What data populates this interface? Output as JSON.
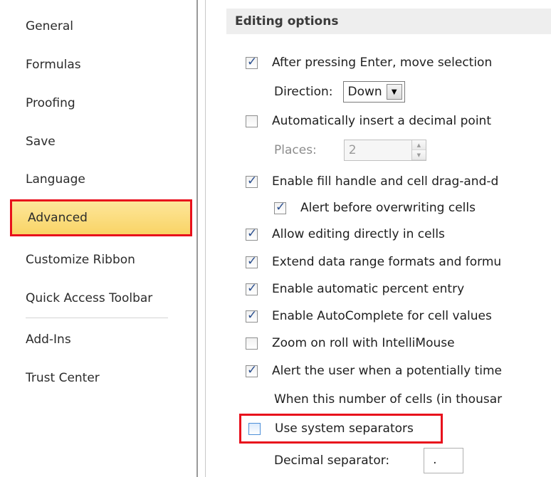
{
  "sidebar": {
    "items": [
      {
        "label": "General"
      },
      {
        "label": "Formulas"
      },
      {
        "label": "Proofing"
      },
      {
        "label": "Save"
      },
      {
        "label": "Language"
      },
      {
        "label": "Advanced",
        "selected": true
      },
      {
        "label": "Customize Ribbon"
      },
      {
        "label": "Quick Access Toolbar"
      },
      {
        "label": "Add-Ins"
      },
      {
        "label": "Trust Center"
      }
    ]
  },
  "section": {
    "title": "Editing options"
  },
  "options": {
    "after_enter": {
      "label": "After pressing Enter, move selection",
      "checked": true
    },
    "direction": {
      "label": "Direction:",
      "value": "Down"
    },
    "auto_decimal": {
      "label": "Automatically insert a decimal point",
      "checked": false
    },
    "places": {
      "label": "Places:",
      "value": "2"
    },
    "fill_handle": {
      "label": "Enable fill handle and cell drag-and-d",
      "checked": true
    },
    "alert_overwrite": {
      "label": "Alert before overwriting cells",
      "checked": true
    },
    "edit_in_cells": {
      "label": "Allow editing directly in cells",
      "checked": true
    },
    "extend_formats": {
      "label": "Extend data range formats and formu",
      "checked": true
    },
    "auto_percent": {
      "label": "Enable automatic percent entry",
      "checked": true
    },
    "autocomplete": {
      "label": "Enable AutoComplete for cell values",
      "checked": true
    },
    "zoom_roll": {
      "label": "Zoom on roll with IntelliMouse",
      "checked": false
    },
    "alert_time": {
      "label": "Alert the user when a potentially time",
      "checked": true
    },
    "cells_thousands": {
      "label": "When this number of cells (in thousar"
    },
    "system_separators": {
      "label": "Use system separators",
      "checked": false
    },
    "decimal_separator": {
      "label": "Decimal separator:",
      "value": "."
    }
  },
  "colors": {
    "highlight": "#e8101c",
    "selected_bg": "#f9d466",
    "check": "#2b4f8f"
  }
}
